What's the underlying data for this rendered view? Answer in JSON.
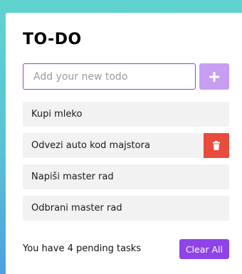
{
  "app": {
    "title": "TO-DO"
  },
  "input": {
    "placeholder": "Add your new todo",
    "value": ""
  },
  "add_button": {
    "icon": "plus-icon"
  },
  "todos": [
    {
      "text": "Kupi mleko",
      "hovered": false
    },
    {
      "text": "Odvezi auto kod majstora",
      "hovered": true
    },
    {
      "text": "Napiši master rad",
      "hovered": false
    },
    {
      "text": "Odbrani master rad",
      "hovered": false
    }
  ],
  "delete_button": {
    "icon": "trash-icon"
  },
  "footer": {
    "pending_prefix": "You have ",
    "pending_count": "4",
    "pending_suffix": " pending tasks",
    "clear_label": "Clear All"
  },
  "colors": {
    "accent": "#8e44e8",
    "accent_light": "#c79ef2",
    "danger": "#e74c3c",
    "item_bg": "#f2f2f2"
  }
}
